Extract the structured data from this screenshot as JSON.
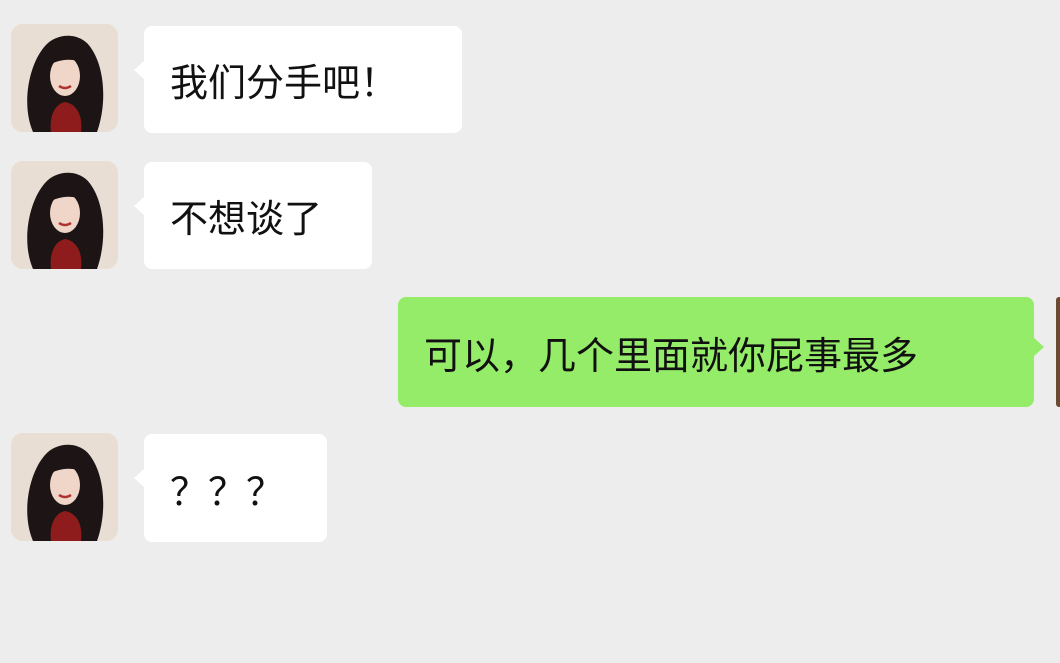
{
  "messages": [
    {
      "from": "other",
      "text": "我们分手吧！",
      "avatar_icon": "woman-portrait-avatar-icon"
    },
    {
      "from": "other",
      "text": "不想谈了",
      "avatar_icon": "woman-portrait-avatar-icon"
    },
    {
      "from": "self",
      "text": "可以，几个里面就你屁事最多"
    },
    {
      "from": "other",
      "text": "？？？",
      "avatar_icon": "woman-portrait-avatar-icon"
    }
  ],
  "colors": {
    "background": "#ededed",
    "incoming_bubble": "#ffffff",
    "outgoing_bubble": "#95ec69"
  }
}
